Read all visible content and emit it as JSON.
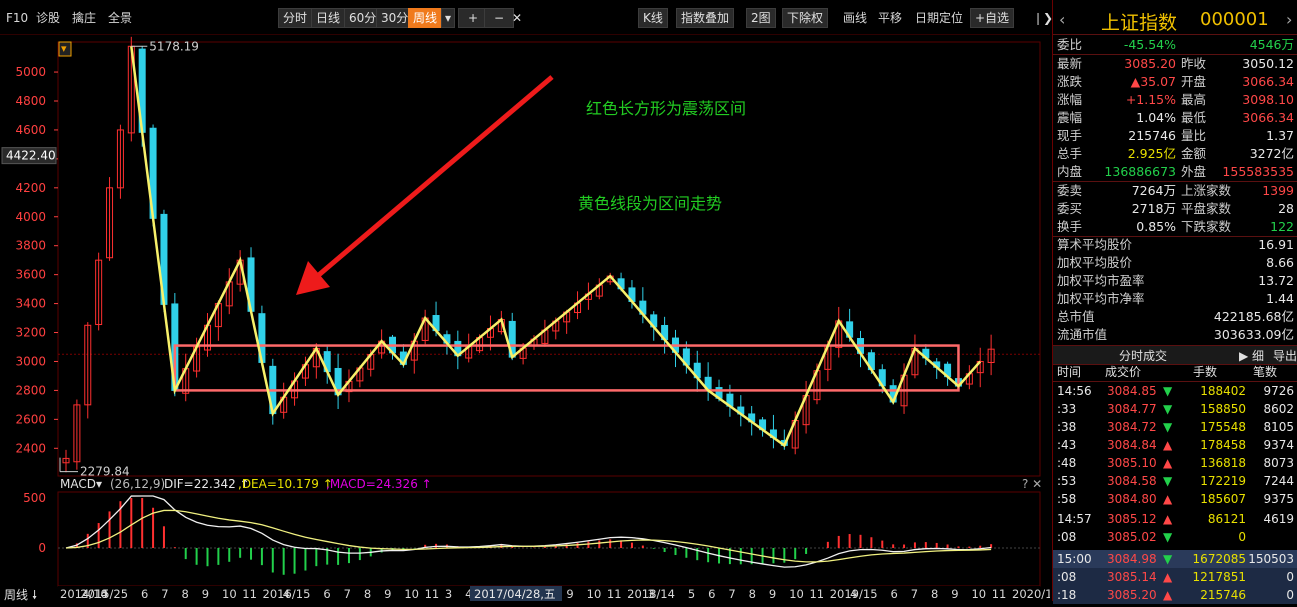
{
  "toolbar": {
    "left_items": [
      "F10",
      "诊股",
      "擒庄",
      "全景"
    ],
    "periods": [
      "分时",
      "日线",
      "60分",
      "30分",
      "周线"
    ],
    "active_period": "周线",
    "plus": "+",
    "minus": "−",
    "right_items": [
      "K线",
      "指数叠加",
      "2图",
      "下除权",
      "画线",
      "平移",
      "日期定位",
      "+自选"
    ]
  },
  "chart_data": {
    "type": "candlestick",
    "period": "weekly",
    "y_axis_ticks": [
      2400,
      2600,
      2800,
      3000,
      3200,
      3400,
      3600,
      3800,
      4000,
      4200,
      4400,
      4600,
      4800,
      5000
    ],
    "ylim": [
      2250,
      5180
    ],
    "current_price_label": "4422.40",
    "high_label": "5178.19",
    "low_label": "2279.84",
    "x_axis_labels": [
      "2014/10",
      "2015/2",
      "4",
      "5",
      "6",
      "7",
      "8",
      "9",
      "10",
      "11",
      "2016/1",
      "4",
      "5",
      "6",
      "7",
      "8",
      "9",
      "10",
      "11",
      "3",
      "4",
      "5",
      "6",
      "7",
      "8",
      "9",
      "10",
      "11",
      "2018/1",
      "3",
      "4",
      "5",
      "6",
      "7",
      "8",
      "9",
      "10",
      "11",
      "2019/1",
      "4",
      "5",
      "6",
      "7",
      "8",
      "9",
      "10",
      "11",
      "2020/1"
    ],
    "cursor_date": "2017/04/28,五",
    "annotations": [
      "红色长方形为震荡区间",
      "黄色线段为区间走势"
    ],
    "range_box": {
      "top": 3110,
      "bottom": 2800
    },
    "yellow_zigzag": [
      [
        6,
        5178
      ],
      [
        10,
        2800
      ],
      [
        16,
        3700
      ],
      [
        19,
        2640
      ],
      [
        23,
        3090
      ],
      [
        25,
        2770
      ],
      [
        29,
        3140
      ],
      [
        31,
        2980
      ],
      [
        33,
        3300
      ],
      [
        36,
        3040
      ],
      [
        40,
        3290
      ],
      [
        41,
        3030
      ],
      [
        50,
        3590
      ],
      [
        59,
        2800
      ],
      [
        66,
        2420
      ],
      [
        71,
        3280
      ],
      [
        76,
        2720
      ],
      [
        78,
        3090
      ],
      [
        82,
        2830
      ],
      [
        84,
        3000
      ]
    ],
    "macd": {
      "label": "MACD",
      "params": "(26,12,9)",
      "dif": "DIF=22.342",
      "dea": ",DEA=10.179",
      "macd": ",MACD=24.326",
      "y_ticks": [
        500,
        0
      ]
    }
  },
  "quote": {
    "title": "上证指数",
    "code": "000001",
    "weibi_label": "委比",
    "weibi": "-45.54%",
    "weicha": "4546万",
    "latest_label": "最新",
    "latest": "3085.20",
    "prevclose_label": "昨收",
    "prevclose": "3050.12",
    "change_label": "涨跌",
    "change": "▲35.07",
    "open_label": "开盘",
    "open": "3066.34",
    "pct_label": "涨幅",
    "pct": "+1.15%",
    "high_label": "最高",
    "high": "3098.10",
    "amp_label": "震幅",
    "amp": "1.04%",
    "low_label": "最低",
    "low": "3066.34",
    "curvol_label": "现手",
    "curvol": "215746",
    "volratio_label": "量比",
    "volratio": "1.37",
    "total_label": "总手",
    "total": "2.925亿",
    "amount_label": "金额",
    "amount": "3272亿",
    "inner_label": "内盘",
    "inner": "136886673",
    "outer_label": "外盘",
    "outer": "155583535",
    "sell_label": "委卖",
    "sell": "7264万",
    "up_label": "上涨家数",
    "up": "1399",
    "buy_label": "委买",
    "buy": "2718万",
    "flat_label": "平盘家数",
    "flat": "28",
    "turn_label": "换手",
    "turn": "0.85%",
    "down_label": "下跌家数",
    "down": "122",
    "avg1_label": "算术平均股价",
    "avg1": "16.91",
    "avg2_label": "加权平均股价",
    "avg2": "8.66",
    "pe_label": "加权平均市盈率",
    "pe": "13.72",
    "pb_label": "加权平均市净率",
    "pb": "1.44",
    "mcap_label": "总市值",
    "mcap": "422185.68亿",
    "fmcap_label": "流通市值",
    "fmcap": "303633.09亿"
  },
  "trades": {
    "header": "分时成交",
    "detail": "细",
    "export": "导出",
    "cols": [
      "时间",
      "成交价",
      "手数",
      "笔数"
    ],
    "rows": [
      {
        "t": "14:56",
        "p": "3084.85",
        "d": "down",
        "v": "188402",
        "n": "9726"
      },
      {
        "t": ":33",
        "p": "3084.77",
        "d": "down",
        "v": "158850",
        "n": "8602"
      },
      {
        "t": ":38",
        "p": "3084.72",
        "d": "down",
        "v": "175548",
        "n": "8105"
      },
      {
        "t": ":43",
        "p": "3084.84",
        "d": "up",
        "v": "178458",
        "n": "9374"
      },
      {
        "t": ":48",
        "p": "3085.10",
        "d": "up",
        "v": "136818",
        "n": "8073"
      },
      {
        "t": ":53",
        "p": "3084.58",
        "d": "down",
        "v": "172219",
        "n": "7244"
      },
      {
        "t": ":58",
        "p": "3084.80",
        "d": "up",
        "v": "185607",
        "n": "9375"
      },
      {
        "t": "14:57",
        "p": "3085.12",
        "d": "up",
        "v": "86121",
        "n": "4619"
      },
      {
        "t": ":08",
        "p": "3085.02",
        "d": "down",
        "v": "0",
        "n": ""
      },
      {
        "t": "15:00",
        "p": "3084.98",
        "d": "down",
        "v": "1672085",
        "n": "150503"
      },
      {
        "t": ":08",
        "p": "3085.14",
        "d": "up",
        "v": "1217851",
        "n": "0"
      },
      {
        "t": ":18",
        "p": "3085.20",
        "d": "up",
        "v": "215746",
        "n": "0"
      }
    ]
  },
  "bottom": {
    "label": "周线"
  },
  "colors": {
    "up": "#ff3030",
    "down": "#30d0e8",
    "grid": "#5a0000",
    "box": "#ff6a6a",
    "zig": "#f7f06a",
    "arrow": "#ee1b1b",
    "note": "#22cc22"
  }
}
